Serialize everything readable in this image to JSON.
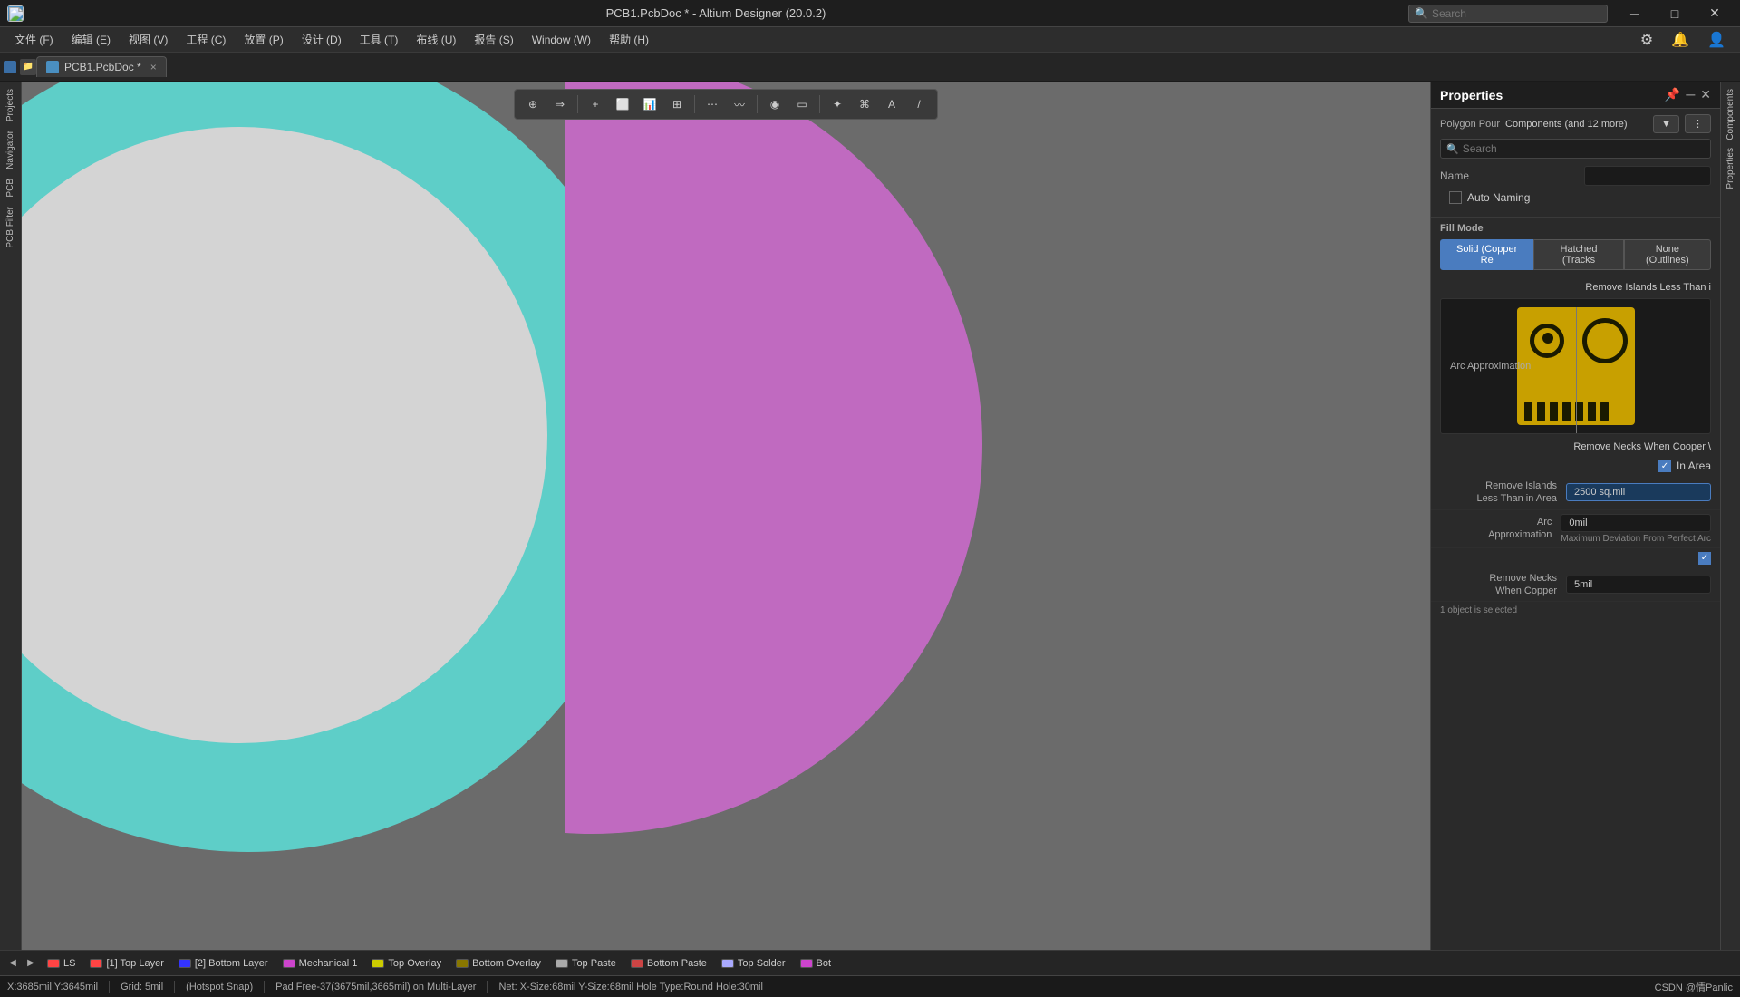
{
  "titlebar": {
    "title": "PCB1.PcbDoc * - Altium Designer (20.0.2)",
    "search_placeholder": "Search",
    "minimize": "─",
    "restore": "□",
    "close": "✕"
  },
  "menubar": {
    "items": [
      "文件 (F)",
      "编辑 (E)",
      "视图 (V)",
      "工程 (C)",
      "放置 (P)",
      "设计 (D)",
      "工具 (T)",
      "布线 (U)",
      "报告 (S)",
      "Window (W)",
      "帮助 (H)"
    ]
  },
  "tab": {
    "label": "PCB1.PcbDoc *",
    "close": "×"
  },
  "toolbar": {
    "tools": [
      "⊕",
      "⇒",
      "+",
      "⬜",
      "📊",
      "⊞",
      "⋯",
      "〰",
      "◉",
      "▭",
      "✦",
      "⌘",
      "A",
      "/"
    ]
  },
  "properties_panel": {
    "title": "Properties",
    "search_placeholder": "Search",
    "header": {
      "polygon_pour": "Polygon Pour",
      "components_label": "Components (and 12 more)"
    },
    "name_label": "Name",
    "auto_naming": "Auto Naming",
    "fill_mode": {
      "label": "Fill Mode",
      "options": [
        {
          "label": "Solid (Copper Re",
          "active": true
        },
        {
          "label": "Hatched (Tracks",
          "active": false
        },
        {
          "label": "None (Outlines)",
          "active": false
        }
      ]
    },
    "remove_islands_header": "Remove Islands Less Than i",
    "remove_necks_label": "Remove Necks When Cooper \\",
    "in_area_label": "In Area",
    "in_area_checked": true,
    "remove_islands": {
      "label": "Remove Islands\nLess Than in Area",
      "value": "2500 sq.mil"
    },
    "arc_approximation": {
      "label": "Arc\nApproximation",
      "value": "0mil",
      "sub_label": "Maximum Deviation From Perfect Arc"
    },
    "checked_box": "✓",
    "remove_necks_when_copper": {
      "label": "Remove Necks\nWhen Copper",
      "value": "5mil"
    },
    "selected_count": "1 object is selected"
  },
  "layerbar": {
    "nav_prev": "◀",
    "nav_next": "▶",
    "layers": [
      {
        "color": "#ff4444",
        "label": "LS"
      },
      {
        "color": "#ff4444",
        "label": "[1] Top Layer"
      },
      {
        "color": "#3333ff",
        "label": "[2] Bottom Layer"
      },
      {
        "color": "#cc44cc",
        "label": "Mechanical 1"
      },
      {
        "color": "#cccc00",
        "label": "Top Overlay"
      },
      {
        "color": "#887700",
        "label": "Bottom Overlay"
      },
      {
        "color": "#aaaaaa",
        "label": "Top Paste"
      },
      {
        "color": "#cc4444",
        "label": "Bottom Paste"
      },
      {
        "color": "#aaaaff",
        "label": "Top Solder"
      },
      {
        "color": "#cc44cc",
        "label": "Bot"
      }
    ]
  },
  "statusbar": {
    "coords": "X:3685mil Y:3645mil",
    "grid": "Grid: 5mil",
    "snap": "(Hotspot Snap)",
    "pad_info": "Pad Free-37(3675mil,3665mil) on Multi-Layer",
    "net_info": "Net: X-Size:68mil Y-Size:68mil Hole Type:Round Hole:30mil",
    "right_label": "CSDN @情Panlic"
  },
  "sidebar_labels": {
    "projects": "Projects",
    "navigator": "Navigator",
    "pcb": "PCB",
    "pcb_filter": "PCB Filter"
  },
  "right_sidebar_labels": {
    "components": "Components",
    "properties": "Properties"
  }
}
